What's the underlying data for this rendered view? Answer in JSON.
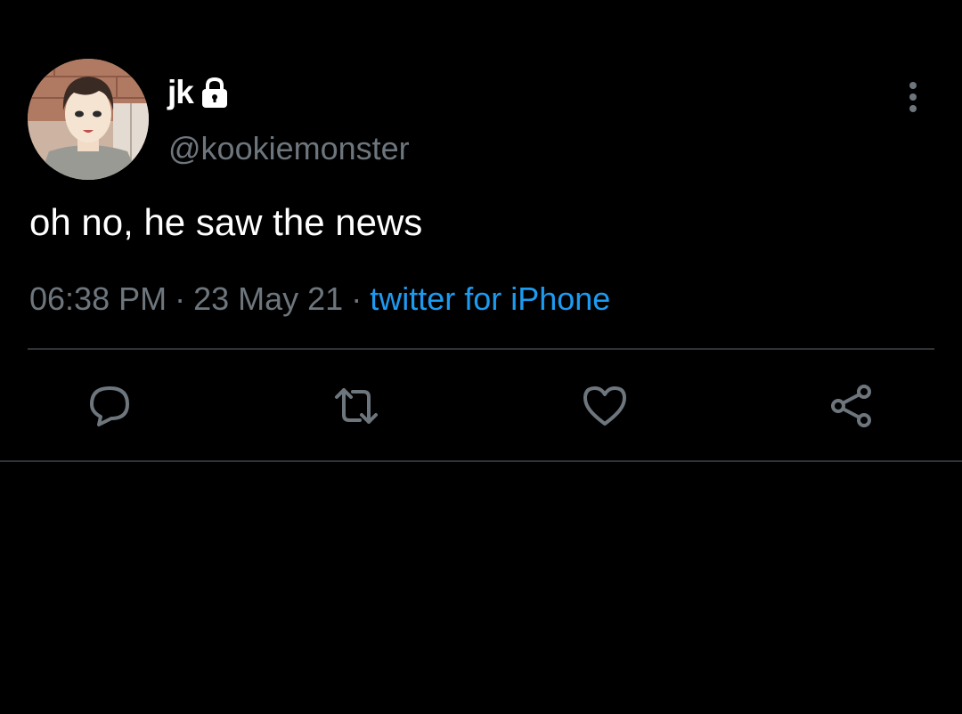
{
  "user": {
    "display_name": "jk",
    "handle": "@kookiemonster",
    "protected": true
  },
  "tweet": {
    "text": "oh no, he saw the news",
    "time": "06:38 PM",
    "separator": "·",
    "date": "23 May 21",
    "source": "twitter for iPhone"
  },
  "actions": [
    {
      "name": "reply",
      "icon": "speech-bubble-icon"
    },
    {
      "name": "retweet",
      "icon": "retweet-arrows-icon"
    },
    {
      "name": "like",
      "icon": "heart-icon"
    },
    {
      "name": "share",
      "icon": "share-nodes-icon"
    }
  ],
  "colors": {
    "background": "#000000",
    "text": "#ffffff",
    "secondary": "#6e767d",
    "link": "#1d9bf0",
    "divider": "#2f3336"
  }
}
